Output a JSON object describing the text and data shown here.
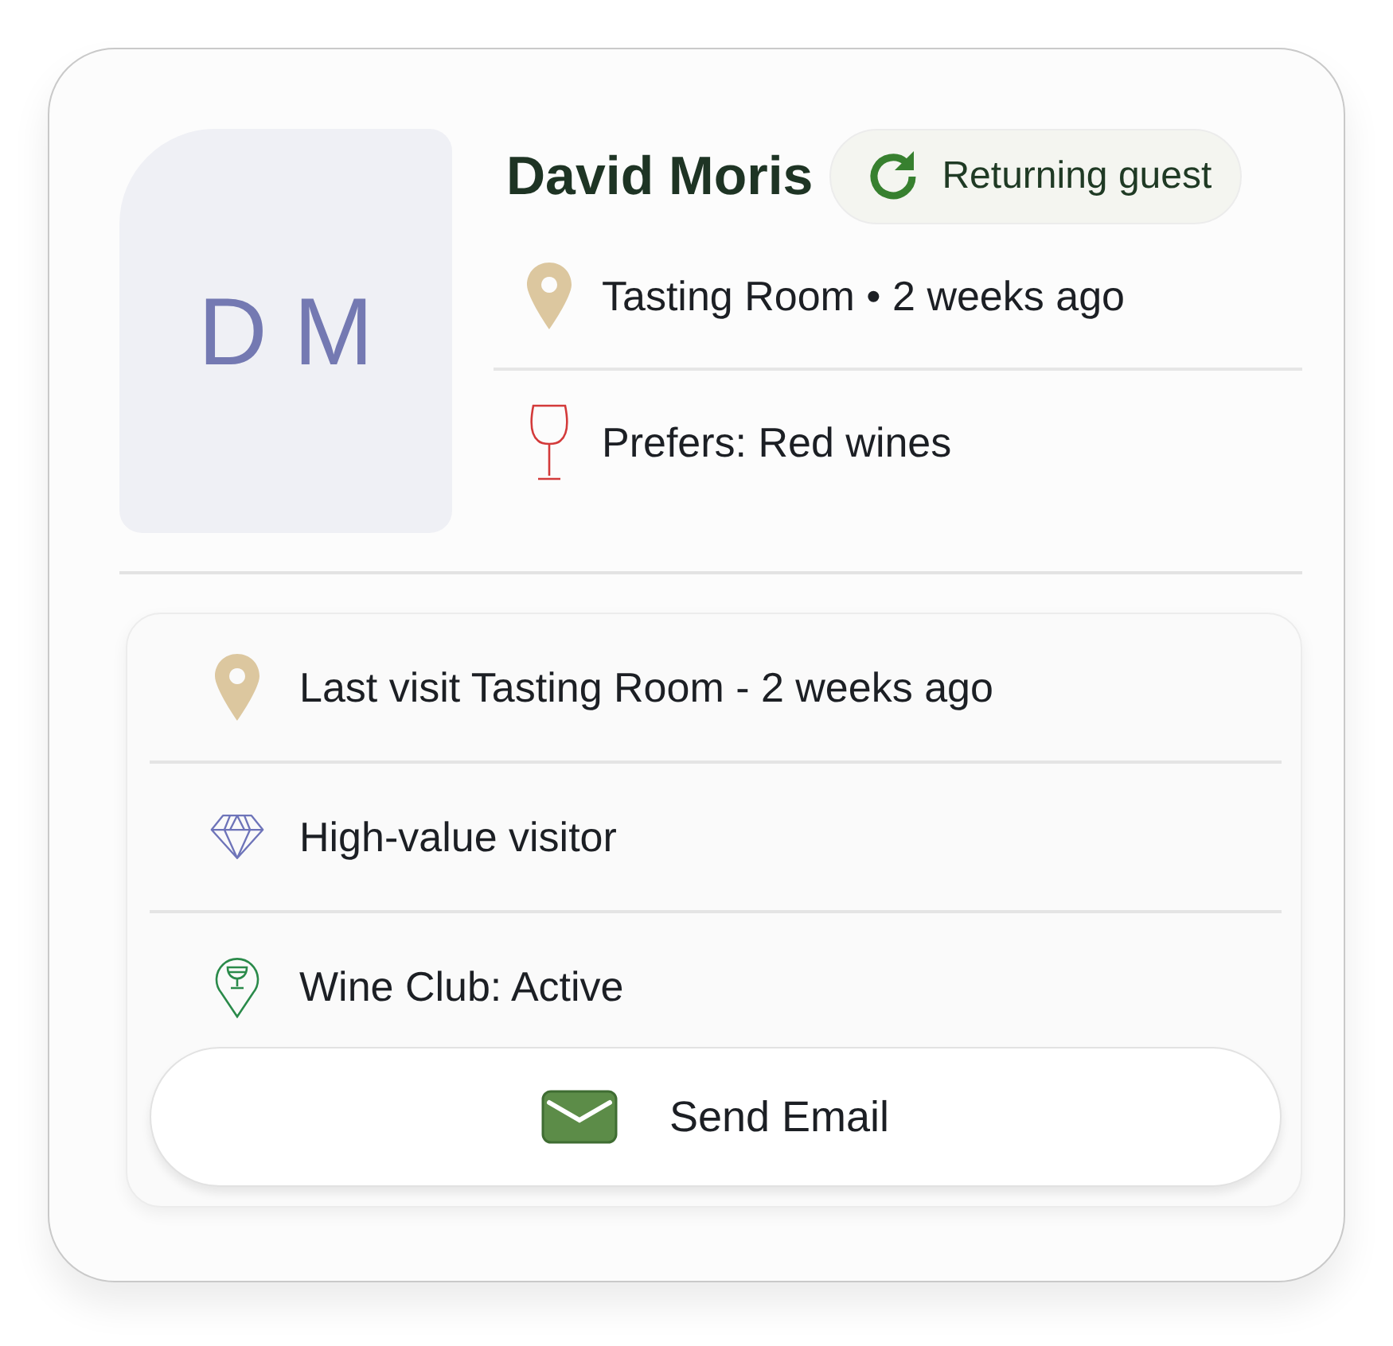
{
  "profile": {
    "initials": "D M",
    "name": "David Moris",
    "badge": {
      "kind": "returning",
      "label": "Returning guest"
    }
  },
  "summary": [
    {
      "kind": "location",
      "text": "Tasting Room • 2 weeks ago"
    },
    {
      "kind": "wine",
      "text": "Prefers: Red wines"
    }
  ],
  "details": [
    {
      "kind": "location",
      "text": "Last visit Tasting Room - 2 weeks ago"
    },
    {
      "kind": "diamond",
      "text": "High-value visitor"
    },
    {
      "kind": "club",
      "text": "Wine Club: Active"
    }
  ],
  "action": {
    "kind": "email",
    "label": "Send Email"
  }
}
